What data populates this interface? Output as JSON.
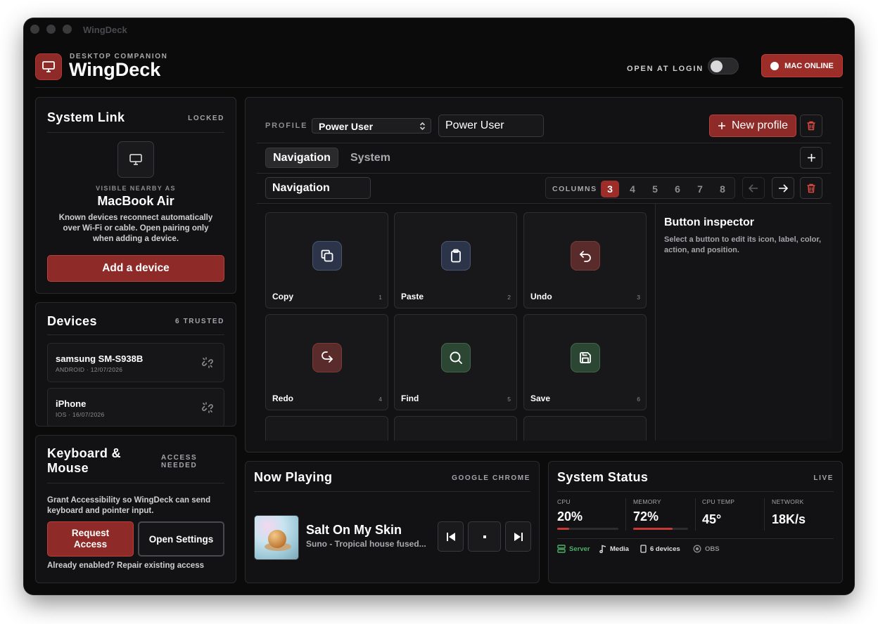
{
  "window": {
    "title": "WingDeck"
  },
  "header": {
    "subtitle": "DESKTOP COMPANION",
    "app_name": "WingDeck",
    "login_label": "OPEN AT LOGIN",
    "login_enabled": false,
    "status_button": "MAC ONLINE"
  },
  "system_link": {
    "title": "System Link",
    "tag": "LOCKED",
    "visible_label": "VISIBLE NEARBY AS",
    "device_name": "MacBook Air",
    "description": "Known devices reconnect automatically over Wi-Fi or cable. Open pairing only when adding a device.",
    "add_button": "Add a device"
  },
  "devices": {
    "title": "Devices",
    "tag": "6 TRUSTED",
    "items": [
      {
        "name": "samsung SM-S938B",
        "meta": "ANDROID · 12/07/2026"
      },
      {
        "name": "iPhone",
        "meta": "IOS · 16/07/2026"
      }
    ]
  },
  "keyboard": {
    "title_line1": "Keyboard &",
    "title_line2": "Mouse",
    "tag_line1": "ACCESS",
    "tag_line2": "NEEDED",
    "description": "Grant Accessibility so WingDeck can send keyboard and pointer input.",
    "request_line1": "Request",
    "request_line2": "Access",
    "settings_button": "Open Settings",
    "repair_text": "Already enabled? Repair existing access"
  },
  "editor": {
    "profile_label": "PROFILE",
    "profile_select": "Power User",
    "profile_name_value": "Power User",
    "new_profile_button": "New profile",
    "tabs": [
      "Navigation",
      "System"
    ],
    "active_tab": 0,
    "page_name_value": "Navigation",
    "columns_label": "COLUMNS",
    "column_options": [
      "3",
      "4",
      "5",
      "6",
      "7",
      "8"
    ],
    "selected_columns": "3",
    "buttons": [
      {
        "label": "Copy",
        "num": "1",
        "icon": "copy-icon",
        "color": "#2b3448"
      },
      {
        "label": "Paste",
        "num": "2",
        "icon": "clipboard-icon",
        "color": "#2b3448"
      },
      {
        "label": "Undo",
        "num": "3",
        "icon": "undo-icon",
        "color": "#5a2b2b"
      },
      {
        "label": "Redo",
        "num": "4",
        "icon": "redo-icon",
        "color": "#5a2b2b"
      },
      {
        "label": "Find",
        "num": "5",
        "icon": "search-icon",
        "color": "#2c4634"
      },
      {
        "label": "Save",
        "num": "6",
        "icon": "save-icon",
        "color": "#2c4634"
      }
    ],
    "inspector_title": "Button inspector",
    "inspector_hint": "Select a button to edit its icon, label, color, action, and position."
  },
  "now_playing": {
    "title": "Now Playing",
    "tag": "GOOGLE CHROME",
    "track": "Salt On My Skin",
    "artist": "Suno - Tropical house fused..."
  },
  "system_status": {
    "title": "System Status",
    "tag": "LIVE",
    "stats": [
      {
        "label": "CPU",
        "value": "20%",
        "level": 0.2
      },
      {
        "label": "MEMORY",
        "value": "72%",
        "level": 0.72
      },
      {
        "label": "CPU TEMP",
        "value": "45°"
      },
      {
        "label": "NETWORK",
        "value": "18K/s"
      }
    ],
    "chips": [
      {
        "label": "Server",
        "icon": "server-icon",
        "color": "#4caf6a"
      },
      {
        "label": "Media",
        "icon": "music-note-icon",
        "color": "#e0e0e3"
      },
      {
        "label": "6 devices",
        "icon": "phone-icon",
        "color": "#e0e0e3"
      },
      {
        "label": "OBS",
        "icon": "record-icon",
        "color": "#8d8d91"
      }
    ]
  },
  "colors": {
    "accent": "#8e2a27",
    "background": "#0b0b0c",
    "panel": "#121214"
  }
}
